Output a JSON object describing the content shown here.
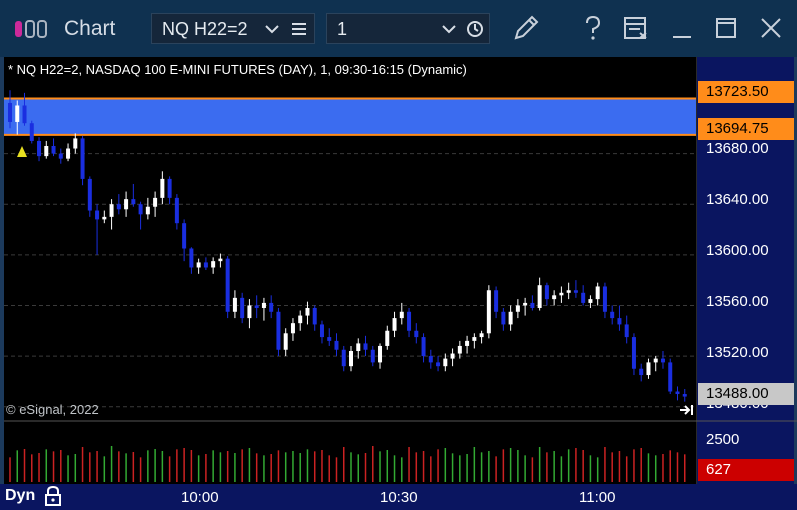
{
  "window": {
    "title": "Chart",
    "symbol": "NQ H22=2",
    "interval": "1"
  },
  "chart": {
    "header": "* NQ H22=2, NASDAQ 100 E-MINI FUTURES (DAY), 1, 09:30-16:15 (Dynamic)",
    "copyright": "© eSignal, 2022",
    "price_labels": [
      "13680.00",
      "13640.00",
      "13600.00",
      "13560.00",
      "13520.00",
      "13480.00"
    ],
    "zone_top_price": "13723.50",
    "zone_bottom_price": "13694.75",
    "last_price": "13488.00",
    "volume_scale": "2500",
    "last_volume": "627",
    "time_labels": [
      "10:00",
      "10:30",
      "11:00"
    ],
    "mode_label": "Dyn",
    "colors": {
      "background": "#000000",
      "zone_fill": "#3b6cf0",
      "zone_border": "#ff8c1a",
      "down_candle": "#1a2ee0",
      "up_candle": "#ffffff",
      "axis_bg": "#0a1560",
      "volume_up": "#33aa33",
      "volume_down": "#cc2222",
      "last_volume_badge": "#cc0000"
    }
  },
  "chart_data": {
    "type": "candlestick",
    "ylim": [
      13460,
      13750
    ],
    "candles": [
      [
        13720,
        13730,
        13700,
        13705
      ],
      [
        13705,
        13722,
        13695,
        13718
      ],
      [
        13718,
        13728,
        13702,
        13704
      ],
      [
        13704,
        13706,
        13688,
        13690
      ],
      [
        13690,
        13693,
        13674,
        13678
      ],
      [
        13678,
        13690,
        13676,
        13686
      ],
      [
        13686,
        13692,
        13678,
        13680
      ],
      [
        13680,
        13684,
        13672,
        13676
      ],
      [
        13676,
        13688,
        13674,
        13684
      ],
      [
        13684,
        13696,
        13680,
        13692
      ],
      [
        13692,
        13694,
        13655,
        13660
      ],
      [
        13660,
        13662,
        13630,
        13635
      ],
      [
        13635,
        13640,
        13600,
        13628
      ],
      [
        13628,
        13635,
        13625,
        13630
      ],
      [
        13630,
        13644,
        13620,
        13640
      ],
      [
        13640,
        13648,
        13632,
        13636
      ],
      [
        13636,
        13650,
        13630,
        13644
      ],
      [
        13644,
        13656,
        13638,
        13640
      ],
      [
        13640,
        13642,
        13620,
        13632
      ],
      [
        13632,
        13645,
        13628,
        13638
      ],
      [
        13638,
        13650,
        13630,
        13645
      ],
      [
        13645,
        13666,
        13640,
        13660
      ],
      [
        13660,
        13662,
        13640,
        13645
      ],
      [
        13645,
        13648,
        13620,
        13625
      ],
      [
        13625,
        13628,
        13595,
        13605
      ],
      [
        13605,
        13606,
        13585,
        13590
      ],
      [
        13590,
        13597,
        13585,
        13594
      ],
      [
        13594,
        13598,
        13588,
        13590
      ],
      [
        13590,
        13598,
        13585,
        13595
      ],
      [
        13595,
        13601,
        13590,
        13597
      ],
      [
        13597,
        13599,
        13550,
        13555
      ],
      [
        13555,
        13572,
        13550,
        13566
      ],
      [
        13566,
        13570,
        13546,
        13550
      ],
      [
        13550,
        13565,
        13542,
        13560
      ],
      [
        13560,
        13568,
        13550,
        13558
      ],
      [
        13558,
        13566,
        13548,
        13562
      ],
      [
        13562,
        13568,
        13550,
        13555
      ],
      [
        13555,
        13558,
        13520,
        13525
      ],
      [
        13525,
        13542,
        13520,
        13538
      ],
      [
        13538,
        13550,
        13532,
        13546
      ],
      [
        13546,
        13556,
        13540,
        13552
      ],
      [
        13552,
        13563,
        13545,
        13558
      ],
      [
        13558,
        13560,
        13540,
        13545
      ],
      [
        13545,
        13548,
        13530,
        13535
      ],
      [
        13535,
        13542,
        13528,
        13532
      ],
      [
        13532,
        13538,
        13520,
        13525
      ],
      [
        13525,
        13528,
        13508,
        13512
      ],
      [
        13512,
        13528,
        13508,
        13524
      ],
      [
        13524,
        13534,
        13518,
        13530
      ],
      [
        13530,
        13536,
        13520,
        13525
      ],
      [
        13525,
        13528,
        13512,
        13515
      ],
      [
        13515,
        13530,
        13510,
        13528
      ],
      [
        13528,
        13544,
        13525,
        13540
      ],
      [
        13540,
        13555,
        13535,
        13550
      ],
      [
        13550,
        13562,
        13545,
        13555
      ],
      [
        13555,
        13558,
        13535,
        13540
      ],
      [
        13540,
        13546,
        13530,
        13535
      ],
      [
        13535,
        13538,
        13515,
        13520
      ],
      [
        13520,
        13525,
        13510,
        13515
      ],
      [
        13515,
        13520,
        13508,
        13512
      ],
      [
        13512,
        13522,
        13508,
        13518
      ],
      [
        13518,
        13526,
        13512,
        13522
      ],
      [
        13522,
        13532,
        13518,
        13528
      ],
      [
        13528,
        13536,
        13522,
        13532
      ],
      [
        13532,
        13538,
        13526,
        13535
      ],
      [
        13535,
        13540,
        13530,
        13538
      ],
      [
        13538,
        13576,
        13534,
        13572
      ],
      [
        13572,
        13575,
        13550,
        13555
      ],
      [
        13555,
        13558,
        13540,
        13545
      ],
      [
        13545,
        13560,
        13540,
        13555
      ],
      [
        13555,
        13565,
        13550,
        13560
      ],
      [
        13560,
        13566,
        13552,
        13562
      ],
      [
        13562,
        13568,
        13556,
        13558
      ],
      [
        13558,
        13582,
        13556,
        13576
      ],
      [
        13576,
        13578,
        13560,
        13565
      ],
      [
        13565,
        13572,
        13560,
        13568
      ],
      [
        13568,
        13575,
        13562,
        13570
      ],
      [
        13570,
        13578,
        13565,
        13572
      ],
      [
        13572,
        13580,
        13566,
        13570
      ],
      [
        13570,
        13576,
        13560,
        13562
      ],
      [
        13562,
        13568,
        13558,
        13565
      ],
      [
        13565,
        13578,
        13560,
        13575
      ],
      [
        13575,
        13578,
        13550,
        13555
      ],
      [
        13555,
        13560,
        13545,
        13550
      ],
      [
        13550,
        13560,
        13540,
        13545
      ],
      [
        13545,
        13552,
        13530,
        13535
      ],
      [
        13535,
        13538,
        13505,
        13510
      ],
      [
        13510,
        13514,
        13500,
        13505
      ],
      [
        13505,
        13518,
        13502,
        13515
      ],
      [
        13515,
        13520,
        13508,
        13518
      ],
      [
        13518,
        13524,
        13510,
        13515
      ],
      [
        13515,
        13518,
        13490,
        13492
      ],
      [
        13492,
        13496,
        13485,
        13490
      ],
      [
        13490,
        13494,
        13484,
        13488
      ]
    ],
    "volumes": [
      2,
      2,
      3,
      2,
      3,
      2,
      2,
      3,
      2,
      3,
      3,
      2,
      3,
      2,
      3,
      2,
      2,
      3,
      2,
      2,
      3,
      3,
      2,
      2,
      3,
      3,
      2,
      3,
      2,
      2,
      3,
      3,
      2,
      3,
      2,
      2,
      3,
      2,
      2,
      3,
      3,
      2,
      2,
      3,
      2,
      2,
      3,
      2,
      2,
      3,
      3,
      2,
      3,
      2,
      2,
      3,
      2,
      3,
      2,
      2,
      3,
      2,
      2,
      3,
      3,
      2,
      3,
      2,
      2,
      3,
      3,
      2,
      2,
      3,
      2,
      3,
      2,
      2,
      3,
      3,
      2,
      2,
      3,
      2,
      3,
      2,
      2,
      3,
      2,
      2,
      3,
      2,
      2,
      2
    ]
  }
}
